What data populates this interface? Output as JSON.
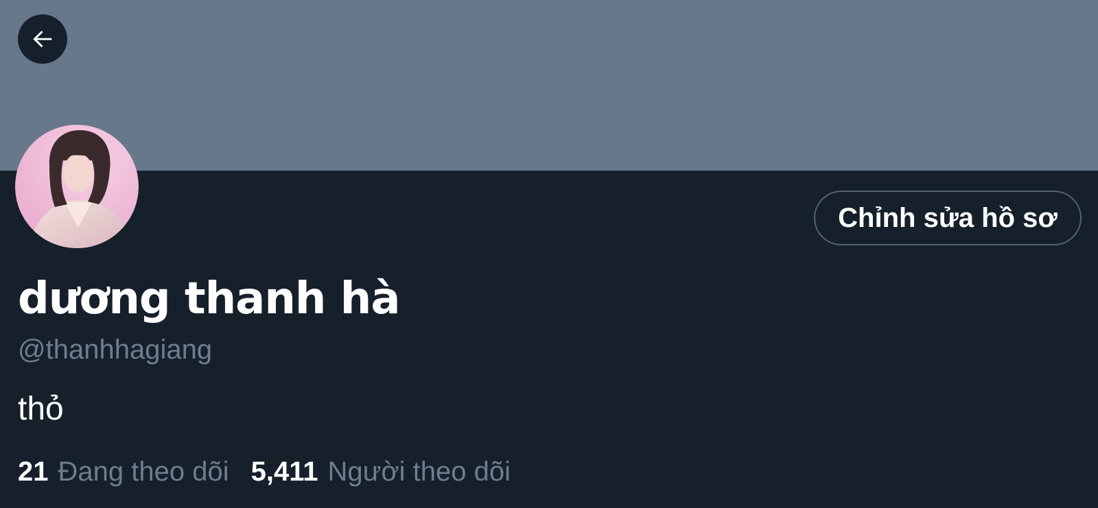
{
  "profile": {
    "display_name": "dương thanh hà",
    "handle": "@thanhhagiang",
    "bio": "thỏ",
    "edit_profile_label": "Chỉnh sửa hồ sơ"
  },
  "stats": {
    "following_count": "21",
    "following_label": "Đang theo dõi",
    "followers_count": "5,411",
    "followers_label": "Người theo dõi"
  },
  "icons": {
    "back": "arrow-left-icon"
  },
  "colors": {
    "background": "#15202b",
    "banner": "#66788a",
    "secondary_text": "#6e7e8e",
    "border": "#536471"
  }
}
